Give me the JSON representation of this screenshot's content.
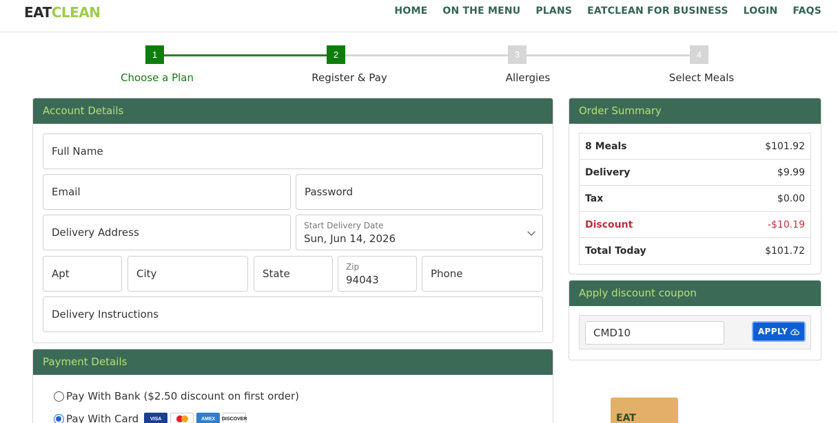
{
  "brand": {
    "part1": "EAT",
    "part2": "CLEAN"
  },
  "nav": [
    {
      "label": "HOME"
    },
    {
      "label": "ON THE MENU"
    },
    {
      "label": "PLANS"
    },
    {
      "label": "EATCLEAN FOR BUSINESS"
    },
    {
      "label": "LOGIN"
    },
    {
      "label": "FAQS"
    }
  ],
  "steps": [
    {
      "num": "1",
      "label": "Choose a Plan"
    },
    {
      "num": "2",
      "label": "Register & Pay"
    },
    {
      "num": "3",
      "label": "Allergies"
    },
    {
      "num": "4",
      "label": "Select Meals"
    }
  ],
  "account": {
    "title": "Account Details",
    "full_name": "Full Name",
    "email": "Email",
    "password": "Password",
    "address": "Delivery Address",
    "start_label": "Start Delivery Date",
    "start_value": "Sun, Jun 14, 2026",
    "apt": "Apt",
    "city": "City",
    "state": "State",
    "zip_label": "Zip",
    "zip_value": "94043",
    "phone": "Phone",
    "instructions": "Delivery Instructions"
  },
  "payment": {
    "title": "Payment Details",
    "bank": "Pay With Bank ($2.50 discount on first order)",
    "card": "Pay With Card",
    "card_brands": [
      "VISA",
      "MC",
      "AMEX",
      "DISCOVER"
    ]
  },
  "summary": {
    "title": "Order Summary",
    "rows": [
      {
        "label": "8 Meals",
        "value": "$101.92"
      },
      {
        "label": "Delivery",
        "value": "$9.99"
      },
      {
        "label": "Tax",
        "value": "$0.00"
      },
      {
        "label": "Discount",
        "value": "-$10.19"
      },
      {
        "label": "Total Today",
        "value": "$101.72"
      }
    ]
  },
  "coupon": {
    "title": "Apply discount coupon",
    "code": "CMD10",
    "apply": "APPLY"
  },
  "product": {
    "label": "EAT"
  },
  "colors": {
    "primary_green": "#0e7d0e",
    "header_green": "#3b6a56",
    "accent_lime": "#b6e07a",
    "discount_red": "#c0313a",
    "apply_blue": "#0d5fd6"
  }
}
